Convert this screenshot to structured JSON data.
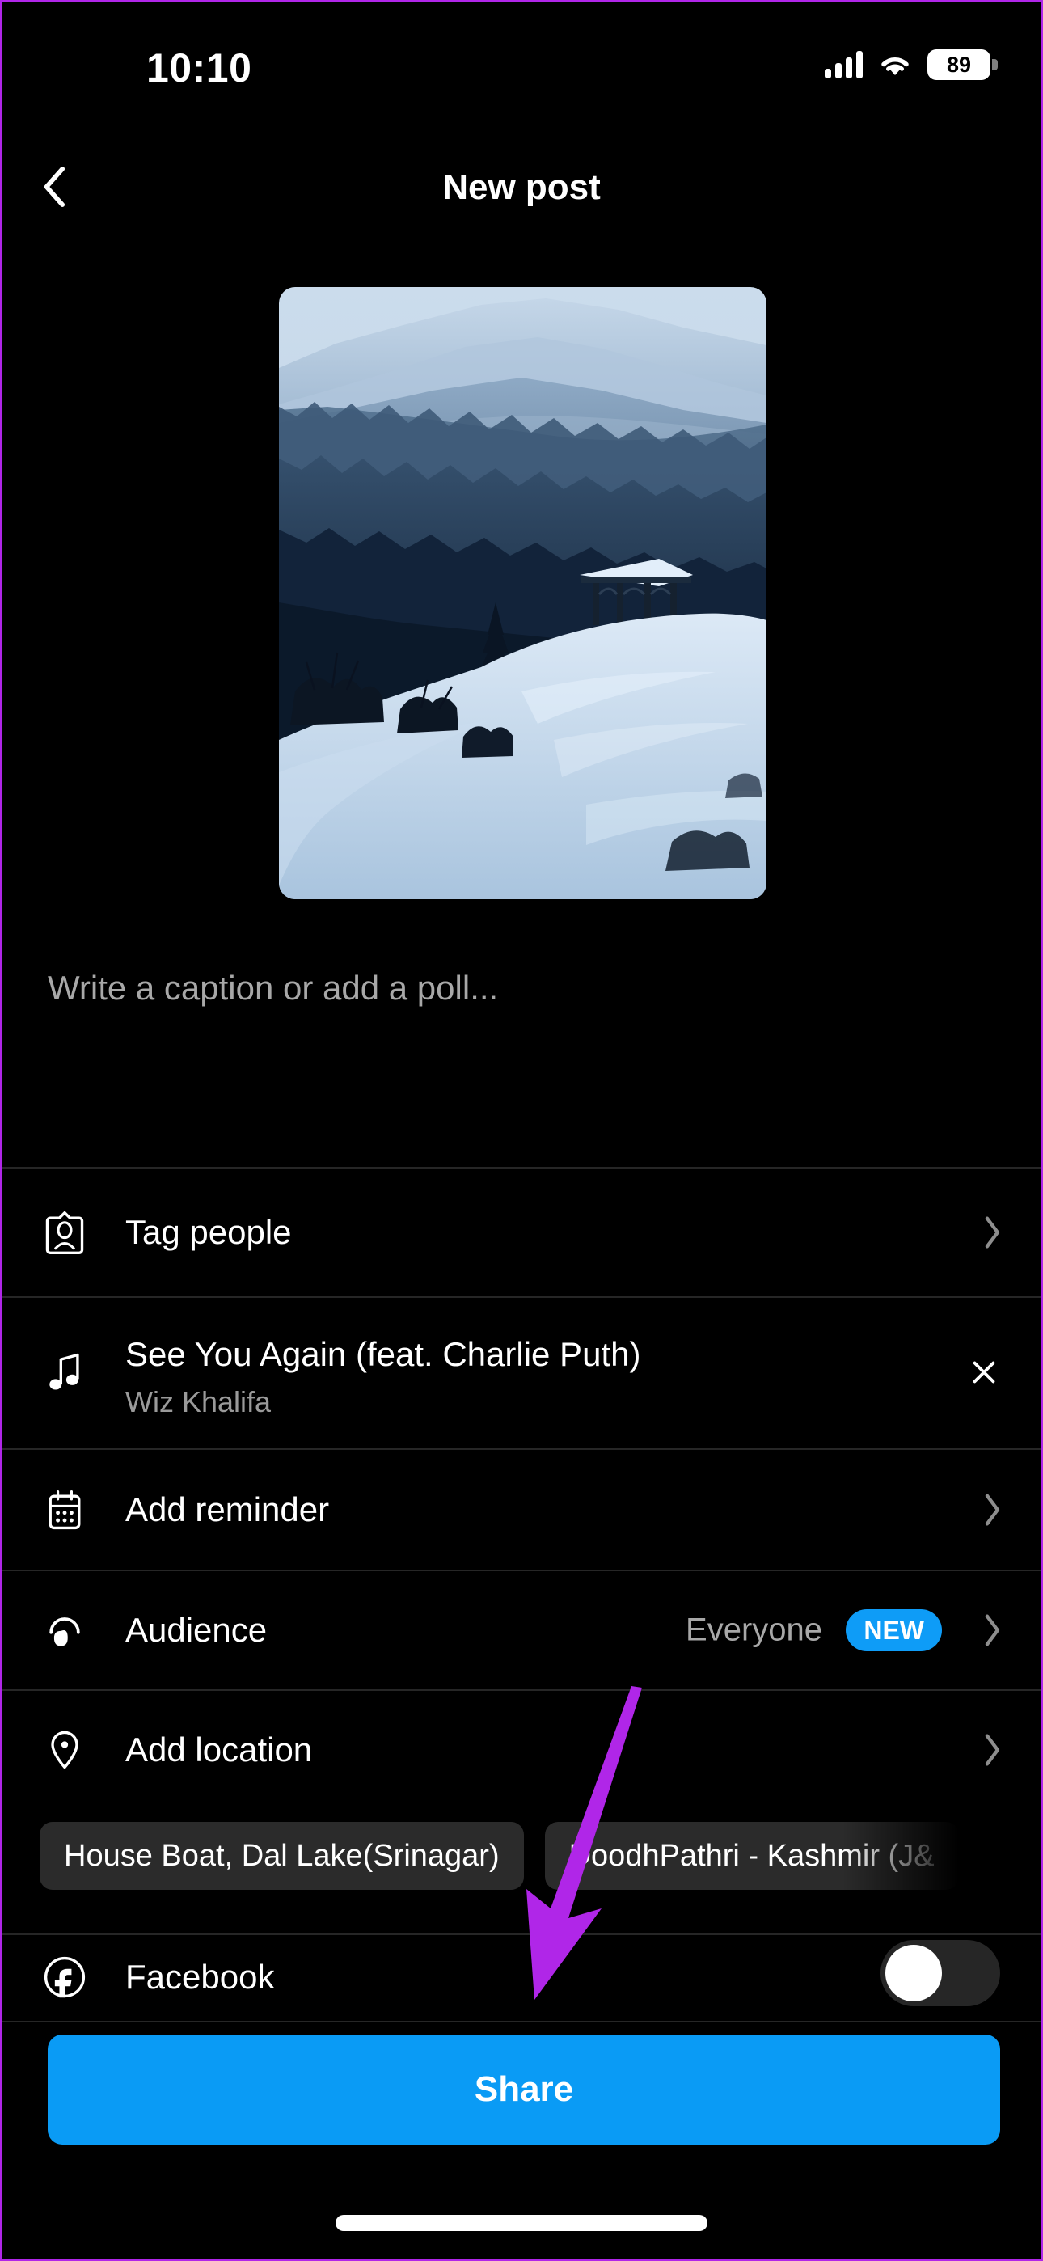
{
  "status_bar": {
    "time": "10:10",
    "battery_percent": "89",
    "cellular_icon": "cellular-signal-icon",
    "wifi_icon": "wifi-icon",
    "battery_icon": "battery-icon"
  },
  "header": {
    "title": "New post",
    "back_icon": "chevron-left-icon"
  },
  "media": {
    "alt": "snowy-mountain-gazebo-photo"
  },
  "caption": {
    "placeholder": "Write a caption or add a poll...",
    "value": ""
  },
  "rows": {
    "tag_people": {
      "label": "Tag people",
      "icon": "tag-people-icon",
      "chevron": "chevron-right-icon"
    },
    "music": {
      "title": "See You Again (feat. Charlie Puth)",
      "artist": "Wiz Khalifa",
      "icon": "music-note-icon",
      "close_icon": "close-icon"
    },
    "reminder": {
      "label": "Add reminder",
      "icon": "calendar-icon",
      "chevron": "chevron-right-icon"
    },
    "audience": {
      "label": "Audience",
      "value": "Everyone",
      "badge": "NEW",
      "icon": "audience-icon",
      "chevron": "chevron-right-icon"
    },
    "location": {
      "label": "Add location",
      "icon": "location-pin-icon",
      "chevron": "chevron-right-icon",
      "suggestions": [
        "House Boat, Dal Lake(Srinagar)",
        "DoodhPathri - Kashmir (J&"
      ]
    },
    "facebook": {
      "label": "Facebook",
      "icon": "facebook-icon",
      "toggle_state": "off"
    }
  },
  "share_button": {
    "label": "Share"
  },
  "colors": {
    "accent_blue": "#0a9bf5",
    "badge_blue": "#0e9cf7",
    "annotation_purple": "#b026e8",
    "background": "#000000",
    "divider": "#262626",
    "chip_background": "#2b2b2b",
    "secondary_text": "#a8a8a8"
  }
}
